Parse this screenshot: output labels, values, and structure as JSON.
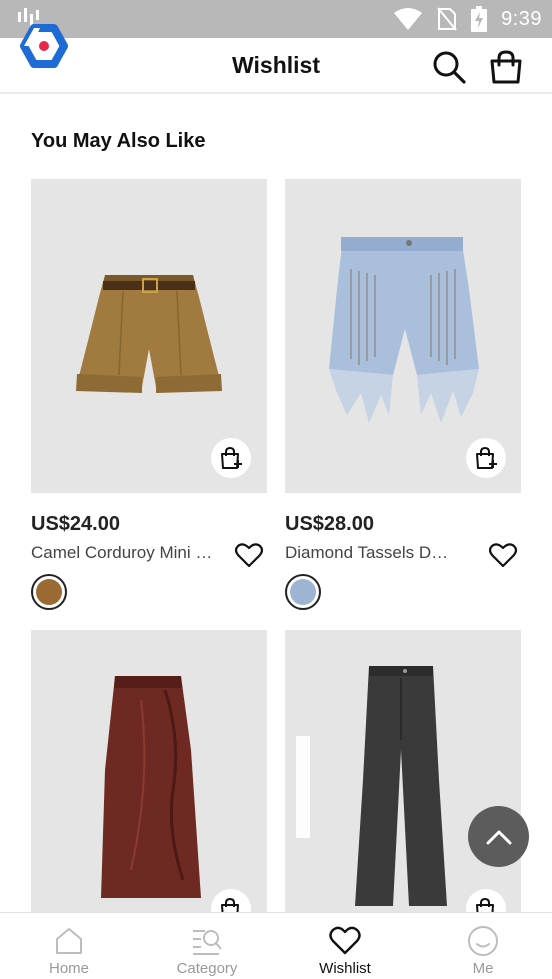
{
  "status_bar": {
    "time": "9:39"
  },
  "header": {
    "title": "Wishlist"
  },
  "section": {
    "title": "You May Also Like"
  },
  "products": [
    {
      "price": "US$24.00",
      "name": "Camel Corduroy Mini Shorts",
      "swatch_color": "#9a6a32"
    },
    {
      "price": "US$28.00",
      "name": "Diamond Tassels Denim Shorts",
      "swatch_color": "#9db4d3"
    },
    {
      "price": "",
      "name": "",
      "swatch_color": "#6e2a22"
    },
    {
      "price": "",
      "name": "",
      "swatch_color": "#3a3a3a"
    }
  ],
  "bottom_nav": [
    {
      "label": "Home",
      "icon": "home-icon"
    },
    {
      "label": "Category",
      "icon": "category-search-icon"
    },
    {
      "label": "Wishlist",
      "icon": "heart-icon",
      "active": true
    },
    {
      "label": "Me",
      "icon": "smile-face-icon"
    }
  ],
  "colors": {
    "accent": "#1e6bd6",
    "brand_dot": "#e5284a",
    "status_bar": "#b8b8b8",
    "image_bg": "#e5e5e5"
  }
}
